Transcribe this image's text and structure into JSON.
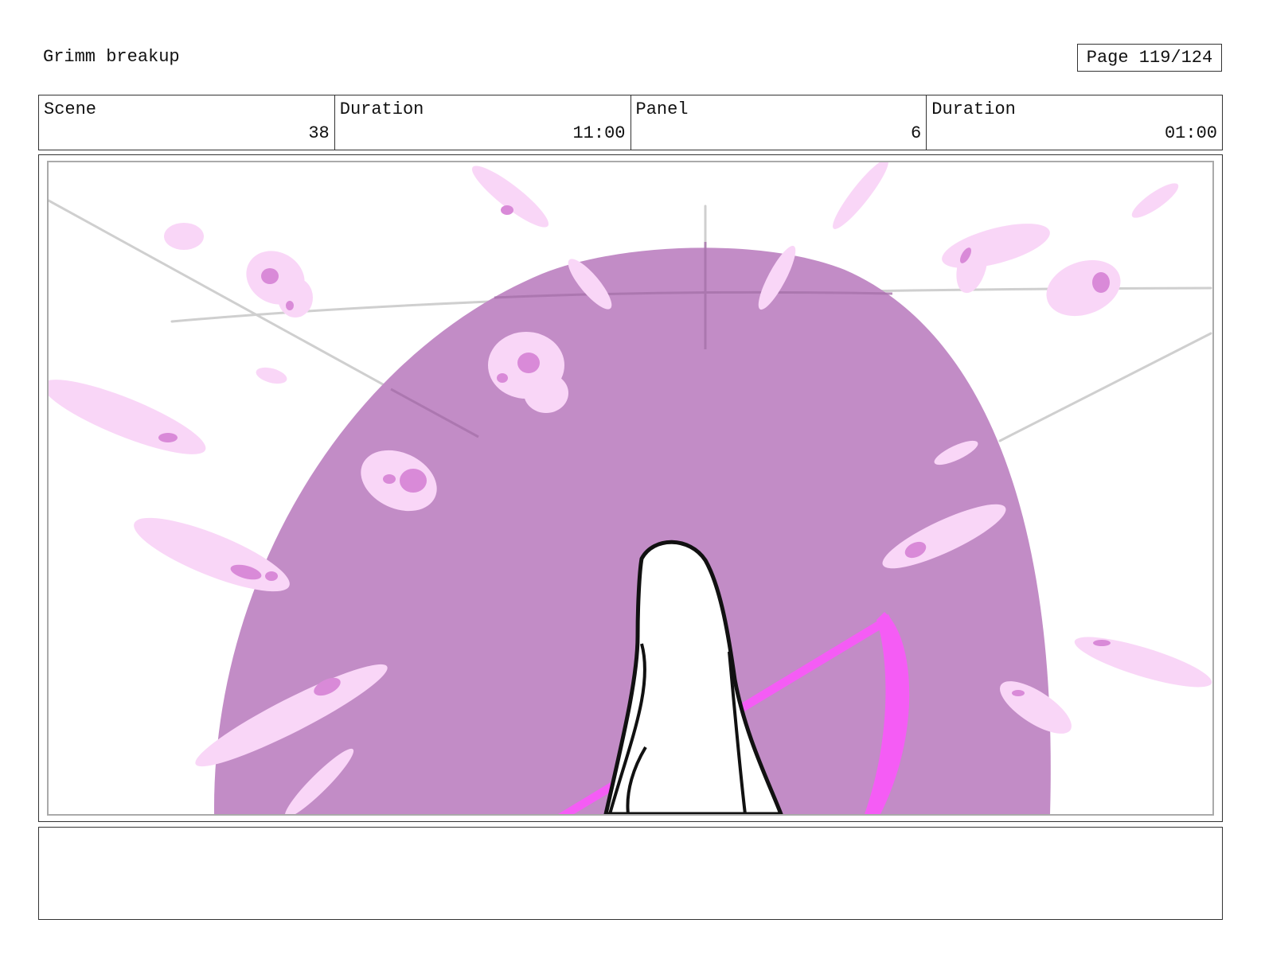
{
  "header": {
    "project_title": "Grimm breakup",
    "page_label": "Page 119/124"
  },
  "info": [
    {
      "label": "Scene",
      "value": "38"
    },
    {
      "label": "Duration",
      "value": "11:00"
    },
    {
      "label": "Panel",
      "value": "6"
    },
    {
      "label": "Duration",
      "value": "01:00"
    }
  ],
  "notes": {
    "text": ""
  },
  "colors": {
    "purple_disc": "#c28cc6",
    "light_pink": "#f9d6f7",
    "dark_pink": "#d98ad8",
    "scythe_magenta": "#f55cf5",
    "sketch_gray": "#cfcfcf"
  },
  "icons": [
    "scythe-illustration",
    "hooded-figure-illustration"
  ]
}
